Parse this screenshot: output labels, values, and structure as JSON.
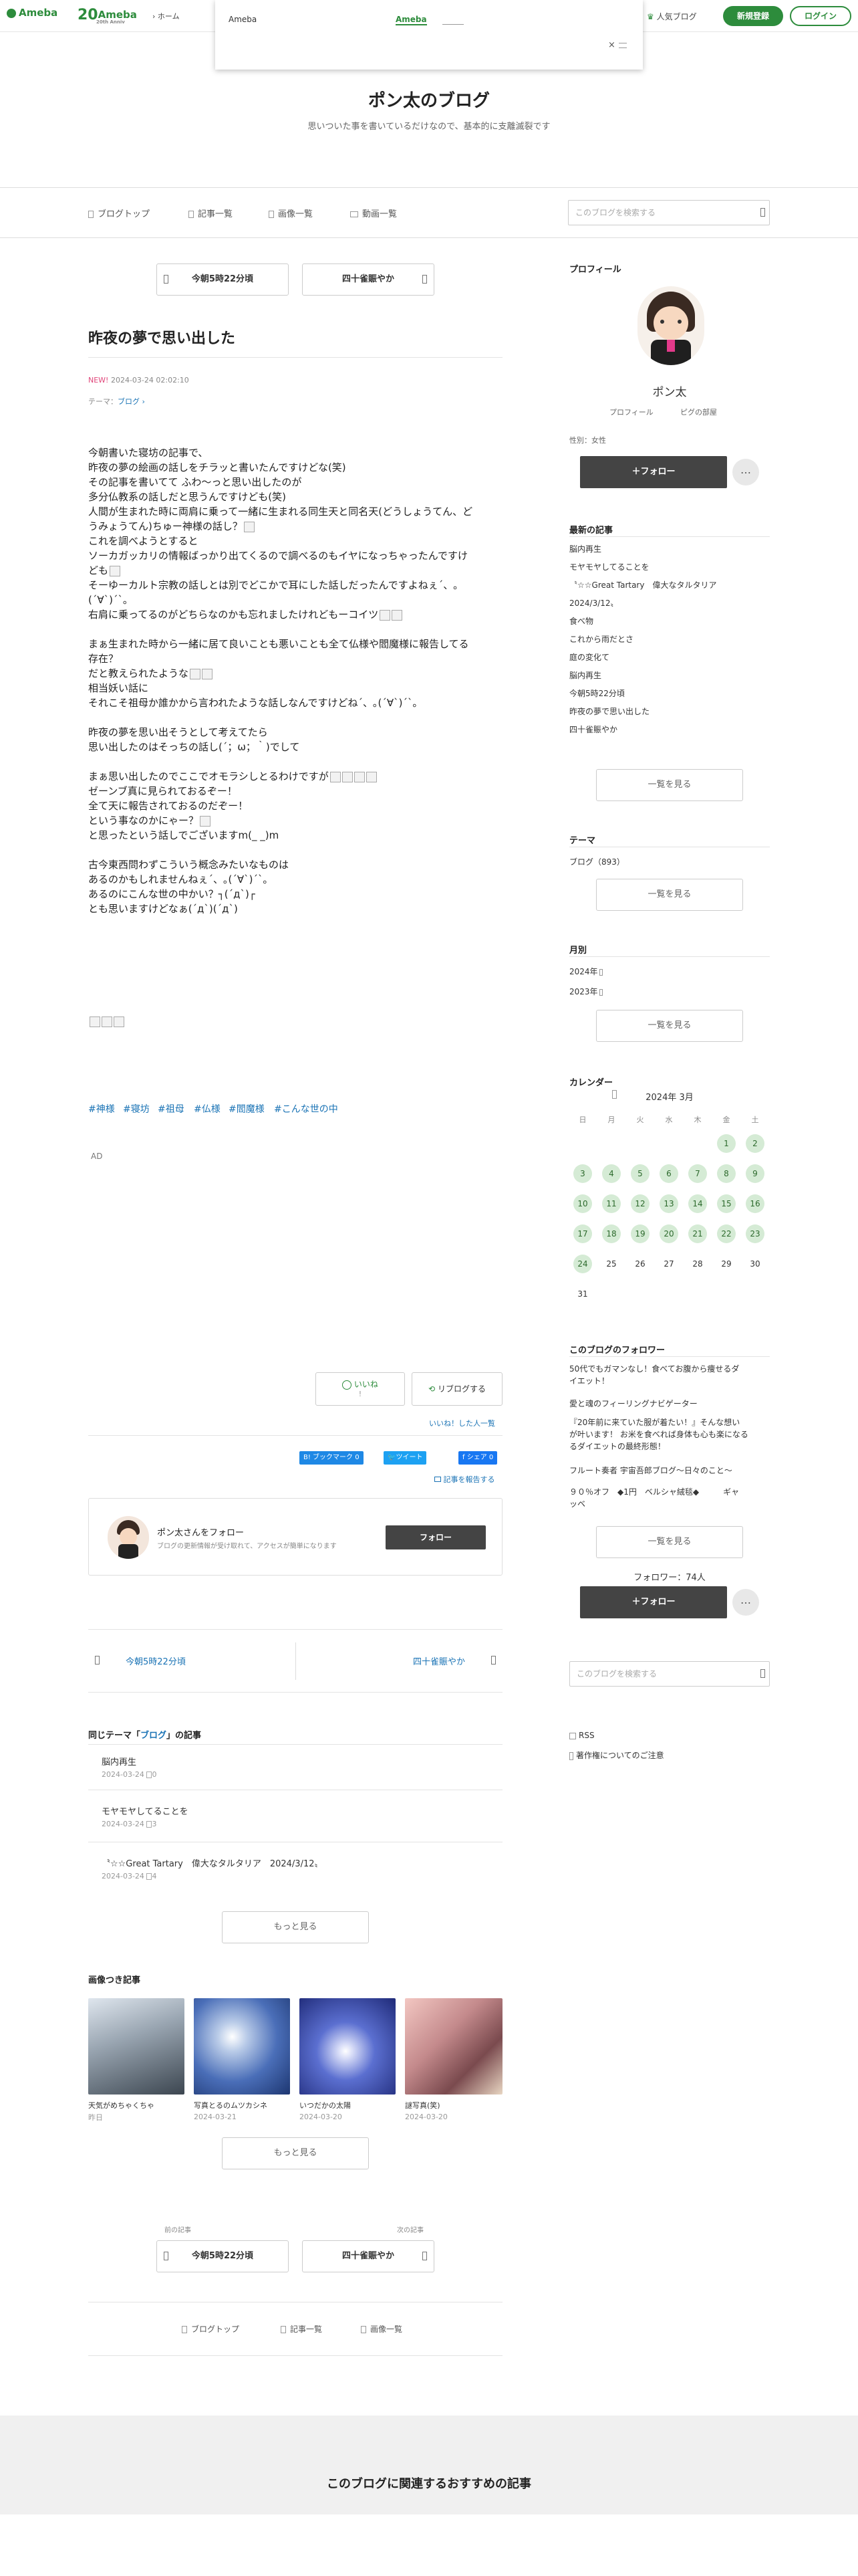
{
  "topbar": {
    "logo": "Ameba",
    "logo2": "Ameba",
    "logo2_sub": "20th Anniv",
    "breadcrumb_home": "ホーム",
    "popular_blog": "人気ブログ",
    "signup": "新規登録",
    "login": "ログイン"
  },
  "popup": {
    "label": "Ameba",
    "link": "Ameba",
    "close": "×"
  },
  "header": {
    "title": "ポン太のブログ",
    "description": "思いついた事を書いているだけなので、基本的に支離滅裂です"
  },
  "gnav": {
    "items": [
      "ブログトップ",
      "記事一覧",
      "画像一覧",
      "動画一覧"
    ],
    "search_placeholder": "このブログを検索する"
  },
  "entry": {
    "prev": "今朝5時22分頃",
    "next": "四十雀賑やか",
    "title": "昨夜の夢で思い出した",
    "new_badge": "NEW!",
    "date": "2024-03-24 02:02:10",
    "theme_label": "テーマ：",
    "theme": "ブログ",
    "lines": [
      "今朝書いた寝坊の記事で、",
      "昨夜の夢の絵画の話しをチラッと書いたんですけどな(笑)",
      "その記事を書いてて ふわ～っと思い出したのが",
      "多分仏教系の話しだと思うんですけども(笑)",
      "人間が生まれた時に両肩に乗って一緒に生まれる同生天と同名天(どうしょうてん、ど",
      "うみょうてん)ちゅー神様の話し？",
      "これを調べようとすると",
      "ソーカガッカリの情報ばっかり出てくるので調べるのもイヤになっちゃったんですけ",
      "ども",
      "そーゆーカルト宗教の話しとは別でどこかで耳にした話しだったんですよねぇ´、｡",
      "(´∀`)´`｡",
      "右肩に乗ってるのがどちらなのかも忘れましたけれどもーコイツ",
      "",
      "まぁ生まれた時から一緒に居て良いことも悪いことも全て仏様や閻魔様に報告してる",
      "存在？",
      "だと教えられたような",
      "相当妖い話に",
      "それこそ祖母か誰かから言われたような話しなんですけどね´、｡(´∀`)´`｡",
      "",
      "昨夜の夢を思い出そうとして考えてたら",
      "思い出したのはそっちの話し(´；ω；｀)でして",
      "",
      "まぁ思い出したのでここでオモラシしとるわけですが",
      "ゼーンブ真に見られておるぞー！",
      "全て天に報告されておるのだぞー！",
      "という事なのかにゃー？",
      "と思ったという話しでございますm(_ _)m",
      "",
      "古今東西問わずこういう概念みたいなものは",
      "あるのかもしれませんねぇ´、｡(´∀`)´`｡",
      "あるのにこんな世の中かい？┐(´д`)┌",
      "とも思いますけどなぁ(´д`)(´д`)"
    ],
    "tags": [
      "#神様",
      "#寝坊",
      "#祖母",
      "#仏様",
      "#閻魔様",
      "#こんな世の中"
    ],
    "ad": "AD",
    "like": "いいね",
    "like_count": "!",
    "reblog": "リブログする",
    "like_list": "いいね！した人一覧",
    "hatena": "B! ブックマーク",
    "hatena_count": "0",
    "tweet": "ツイート",
    "fb_share": "シェア",
    "fb_count": "0",
    "report": "記事を報告する"
  },
  "follow_card": {
    "title": "ポン太さんをフォロー",
    "desc": "ブログの更新情報が受け取れて、アクセスが簡単になります",
    "button": "フォロー"
  },
  "pager": {
    "prev": "今朝5時22分頃",
    "next": "四十雀賑やか"
  },
  "same_theme": {
    "prefix": "同じテーマ「",
    "theme": "ブログ",
    "suffix": "」の記事",
    "items": [
      {
        "title": "脳内再生",
        "date": "2024-03-24",
        "count": "0"
      },
      {
        "title": "モヤモヤしてることを",
        "date": "2024-03-24",
        "count": "3"
      },
      {
        "title": "〝☆☆Great Tartary　偉大なタルタリア　2024/3/12〟",
        "date": "2024-03-24",
        "count": "4"
      }
    ],
    "more": "もっと見る"
  },
  "image_articles": {
    "heading": "画像つき記事",
    "items": [
      {
        "title": "天気がめちゃくちゃ",
        "date": "昨日"
      },
      {
        "title": "写真とるのムツカシネ",
        "date": "2024-03-21"
      },
      {
        "title": "いつだかの太陽",
        "date": "2024-03-20"
      },
      {
        "title": "謎写真(笑)",
        "date": "2024-03-20"
      }
    ],
    "more": "もっと見る"
  },
  "bottom_pager": {
    "prev_label": "前の記事",
    "next_label": "次の記事",
    "prev": "今朝5時22分頃",
    "next": "四十雀賑やか"
  },
  "footer_nav": [
    "ブログトップ",
    "記事一覧",
    "画像一覧"
  ],
  "recommend": "このブログに関連するおすすめの記事",
  "sidebar": {
    "profile_heading": "プロフィール",
    "name": "ポン太",
    "profile_link": "プロフィール",
    "room_link": "ピグの部屋",
    "gender": "性別：女性",
    "follow": "＋フォロー",
    "dots": "…",
    "recent_heading": "最新の記事",
    "recent": [
      "脳内再生",
      "モヤモヤしてることを",
      "〝☆☆Great Tartary　偉大なタルタリア",
      "2024/3/12〟",
      "食べ物",
      "これから雨だとさ",
      "庭の変化て",
      "脳内再生",
      "今朝5時22分頃",
      "昨夜の夢で思い出した",
      "四十雀賑やか"
    ],
    "more": "一覧を見る",
    "theme_heading": "テーマ",
    "theme_item": "ブログ（893）",
    "month_heading": "月別",
    "months": [
      "2024年",
      "2023年"
    ],
    "calendar_heading": "カレンダー",
    "calendar_title": "2024年 3月",
    "weekdays": [
      "日",
      "月",
      "火",
      "水",
      "木",
      "金",
      "土"
    ],
    "followers_heading": "このブログのフォロワー",
    "followers": [
      "50代でもガマンなし！食べてお腹から痩せるダ",
      "イエット！",
      "愛と魂のフィーリングナビゲーター",
      "『20年前に来ていた服が着たい！』そんな想い",
      "が叶います！ お米を食べれば身体も心も楽になる",
      "るダイエットの最終形態！",
      "フルート奏者 宇宙吾郎ブログ〜日々のこと〜",
      "９０％オフ　◆1円　ベルシャ絨毯◆　　　ギャ",
      "ッベ"
    ],
    "follower_count": "フォロワー：74人",
    "search_placeholder": "このブログを検索する",
    "rss": "RSS",
    "copyright": "著作権についてのご注意"
  }
}
